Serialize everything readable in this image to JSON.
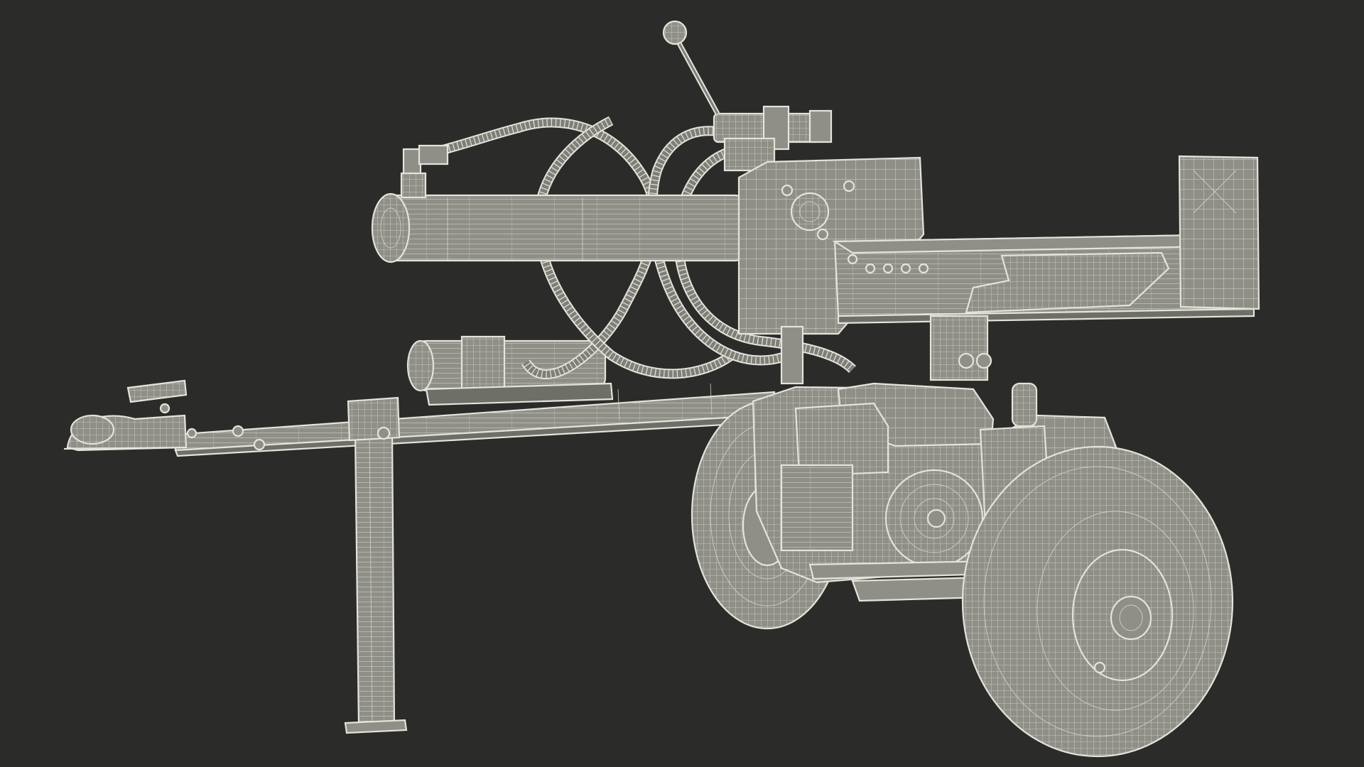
{
  "scene": {
    "subject": "log-splitter-wireframe",
    "background_color": "#2b2b29",
    "wire_color": "#e4e4dc",
    "surface_color": "#8f8f88"
  }
}
